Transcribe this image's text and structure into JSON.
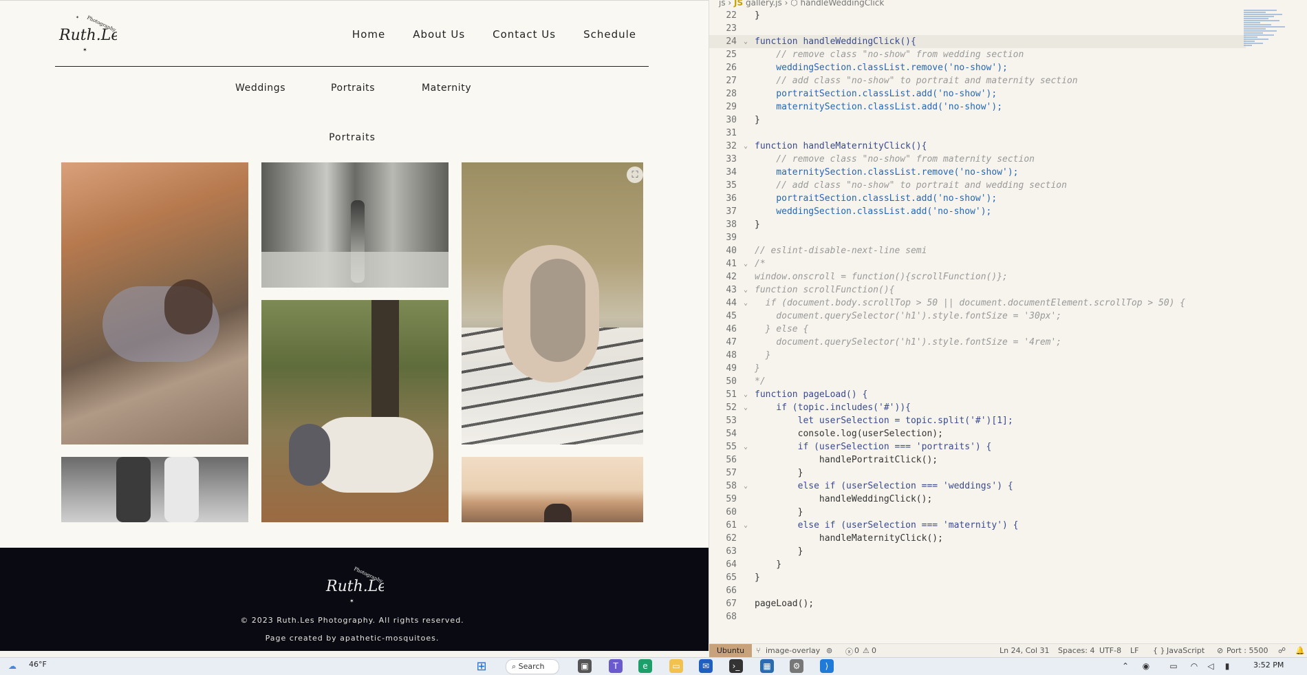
{
  "site": {
    "logo_text": "Ruth.Les",
    "logo_sub": "Photography",
    "nav": [
      "Home",
      "About Us",
      "Contact Us",
      "Schedule"
    ],
    "categories": [
      "Weddings",
      "Portraits",
      "Maternity"
    ],
    "section_title": "Portraits",
    "footer": {
      "copyright": "© 2023 Ruth.Les Photography. All rights reserved.",
      "credit": "Page created by apathetic-mosquitoes."
    }
  },
  "editor": {
    "breadcrumb": [
      "js",
      "gallery.js",
      "handleWeddingClick"
    ],
    "lines": [
      {
        "n": "22",
        "t": "}"
      },
      {
        "n": "23",
        "t": ""
      },
      {
        "n": "24",
        "t": "function handleWeddingClick(){"
      },
      {
        "n": "25",
        "t": "    // remove class \"no-show\" from wedding section"
      },
      {
        "n": "26",
        "t": "    weddingSection.classList.remove('no-show');"
      },
      {
        "n": "27",
        "t": "    // add class \"no-show\" to portrait and maternity section"
      },
      {
        "n": "28",
        "t": "    portraitSection.classList.add('no-show');"
      },
      {
        "n": "29",
        "t": "    maternitySection.classList.add('no-show');"
      },
      {
        "n": "30",
        "t": "}"
      },
      {
        "n": "31",
        "t": ""
      },
      {
        "n": "32",
        "t": "function handleMaternityClick(){"
      },
      {
        "n": "33",
        "t": "    // remove class \"no-show\" from maternity section"
      },
      {
        "n": "34",
        "t": "    maternitySection.classList.remove('no-show');"
      },
      {
        "n": "35",
        "t": "    // add class \"no-show\" to portrait and wedding section"
      },
      {
        "n": "36",
        "t": "    portraitSection.classList.add('no-show');"
      },
      {
        "n": "37",
        "t": "    weddingSection.classList.add('no-show');"
      },
      {
        "n": "38",
        "t": "}"
      },
      {
        "n": "39",
        "t": ""
      },
      {
        "n": "40",
        "t": "// eslint-disable-next-line semi"
      },
      {
        "n": "41",
        "t": "/*"
      },
      {
        "n": "42",
        "t": "window.onscroll = function(){scrollFunction()};"
      },
      {
        "n": "43",
        "t": "function scrollFunction(){"
      },
      {
        "n": "44",
        "t": "  if (document.body.scrollTop > 50 || document.documentElement.scrollTop > 50) {"
      },
      {
        "n": "45",
        "t": "    document.querySelector('h1').style.fontSize = '30px';"
      },
      {
        "n": "46",
        "t": "  } else {"
      },
      {
        "n": "47",
        "t": "    document.querySelector('h1').style.fontSize = '4rem';"
      },
      {
        "n": "48",
        "t": "  }"
      },
      {
        "n": "49",
        "t": "}"
      },
      {
        "n": "50",
        "t": "*/"
      },
      {
        "n": "51",
        "t": "function pageLoad() {"
      },
      {
        "n": "52",
        "t": "    if (topic.includes('#')){"
      },
      {
        "n": "53",
        "t": "        let userSelection = topic.split('#')[1];"
      },
      {
        "n": "54",
        "t": "        console.log(userSelection);"
      },
      {
        "n": "55",
        "t": "        if (userSelection === 'portraits') {"
      },
      {
        "n": "56",
        "t": "            handlePortraitClick();"
      },
      {
        "n": "57",
        "t": "        }"
      },
      {
        "n": "58",
        "t": "        else if (userSelection === 'weddings') {"
      },
      {
        "n": "59",
        "t": "            handleWeddingClick();"
      },
      {
        "n": "60",
        "t": "        }"
      },
      {
        "n": "61",
        "t": "        else if (userSelection === 'maternity') {"
      },
      {
        "n": "62",
        "t": "            handleMaternityClick();"
      },
      {
        "n": "63",
        "t": "        }"
      },
      {
        "n": "64",
        "t": "    }"
      },
      {
        "n": "65",
        "t": "}"
      },
      {
        "n": "66",
        "t": ""
      },
      {
        "n": "67",
        "t": "pageLoad();"
      },
      {
        "n": "68",
        "t": ""
      }
    ],
    "status": {
      "remote": "Ubuntu",
      "branch": "image-overlay",
      "problems": "0",
      "warnings": "0",
      "position": "Ln 24, Col 31",
      "spaces": "Spaces: 4",
      "encoding": "UTF-8",
      "eol": "LF",
      "language": "JavaScript",
      "port": "Port : 5500"
    }
  },
  "taskbar": {
    "weather": "46°F",
    "search": "Search",
    "time": "3:52 PM"
  }
}
